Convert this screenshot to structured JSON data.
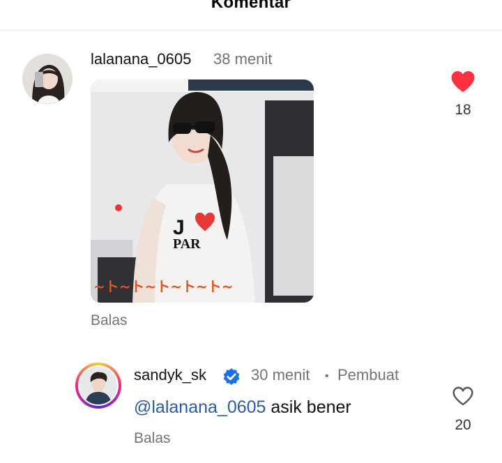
{
  "header": {
    "title": "Komentar"
  },
  "comments": [
    {
      "username": "lalanana_0605",
      "time": "38 menit",
      "gif_caption": "~ト~ト~ト~ト~ト~",
      "shirt_text_top": "J",
      "shirt_text_bottom": "PAR",
      "reply_label": "Balas",
      "likes": "18",
      "liked": true,
      "heart_color": "#ff3040"
    },
    {
      "username": "sandyk_sk",
      "verified": true,
      "time": "30 menit",
      "separator": "•",
      "role": "Pembuat",
      "mention": "@lalanana_0605",
      "text": " asik bener",
      "reply_label": "Balas",
      "likes": "20",
      "liked": false
    }
  ],
  "colors": {
    "verified_blue": "#1d6fe8",
    "mention_blue": "#2b5a9e",
    "muted": "#737373"
  }
}
